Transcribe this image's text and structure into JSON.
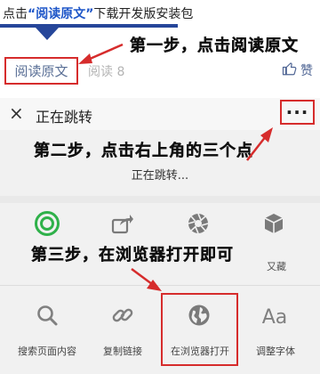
{
  "article": {
    "intro_prefix": "点击",
    "intro_highlight": "“阅读原文”",
    "intro_suffix": "下载开发版安装包",
    "read_original": "阅读原文",
    "read_count": "阅读 8",
    "like_label": "赞"
  },
  "annotations": {
    "step1": "第一步，点击阅读原文",
    "step2": "第二步，点击右上角的三个点",
    "step3": "第三步，在浏览器打开即可"
  },
  "jump_bar": {
    "close_glyph": "×",
    "title": "正在跳转",
    "more_glyph": "···",
    "subtitle": "正在跳转..."
  },
  "share_row": {
    "items": [
      {
        "icon": "moments-icon",
        "label": ""
      },
      {
        "icon": "share-forward-icon",
        "label": ""
      },
      {
        "icon": "aperture-icon",
        "label": ""
      },
      {
        "icon": "cube-icon",
        "label": "收藏",
        "visible_label": "又藏"
      }
    ]
  },
  "action_row": {
    "items": [
      {
        "icon": "search-icon",
        "label": "搜索页面内容"
      },
      {
        "icon": "link-icon",
        "label": "复制链接"
      },
      {
        "icon": "globe-icon",
        "label": "在浏览器打开"
      },
      {
        "icon": "font-size-icon",
        "label": "调整字体",
        "glyph": "Aa"
      }
    ]
  },
  "colors": {
    "annotation_red": "#d62c2c",
    "highlight_blue": "#1e56c8",
    "rule_blue": "#26469a",
    "moments_green": "#2fb14a"
  }
}
